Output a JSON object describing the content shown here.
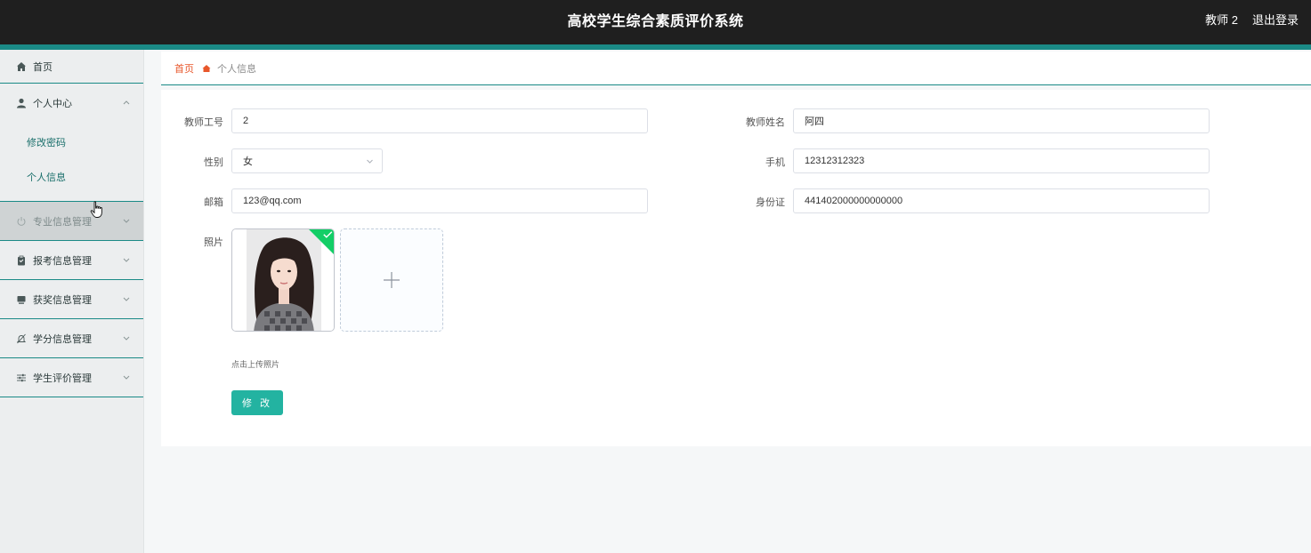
{
  "header": {
    "title": "高校学生综合素质评价系统",
    "user": "教师 2",
    "logout": "退出登录"
  },
  "sidebar": {
    "home": {
      "label": "首页",
      "icon": "home-icon"
    },
    "personal_center": {
      "label": "个人中心",
      "icon": "user-icon",
      "expanded": true,
      "children": [
        "修改密码",
        "个人信息"
      ]
    },
    "items": [
      {
        "label": "专业信息管理",
        "icon": "power-icon",
        "hovered": true
      },
      {
        "label": "报考信息管理",
        "icon": "clipboard-icon"
      },
      {
        "label": "获奖信息管理",
        "icon": "monitor-icon"
      },
      {
        "label": "学分信息管理",
        "icon": "bell-off-icon"
      },
      {
        "label": "学生评价管理",
        "icon": "sliders-icon"
      }
    ]
  },
  "breadcrumb": {
    "home": "首页",
    "current": "个人信息"
  },
  "form": {
    "teacher_id": {
      "label": "教师工号",
      "value": "2"
    },
    "teacher_name": {
      "label": "教师姓名",
      "value": "阿四"
    },
    "gender": {
      "label": "性别",
      "value": "女"
    },
    "phone": {
      "label": "手机",
      "value": "12312312323"
    },
    "email": {
      "label": "邮箱",
      "value": "123@qq.com"
    },
    "id_card": {
      "label": "身份证",
      "value": "441402000000000000"
    },
    "photo": {
      "label": "照片",
      "hint": "点击上传照片"
    },
    "submit": "修 改"
  },
  "colors": {
    "header_bg": "#1f1f1f",
    "accent": "#1a8a86",
    "button": "#23b3a1",
    "breadcrumb_home": "#e8572b",
    "upload_success": "#13ce66"
  }
}
